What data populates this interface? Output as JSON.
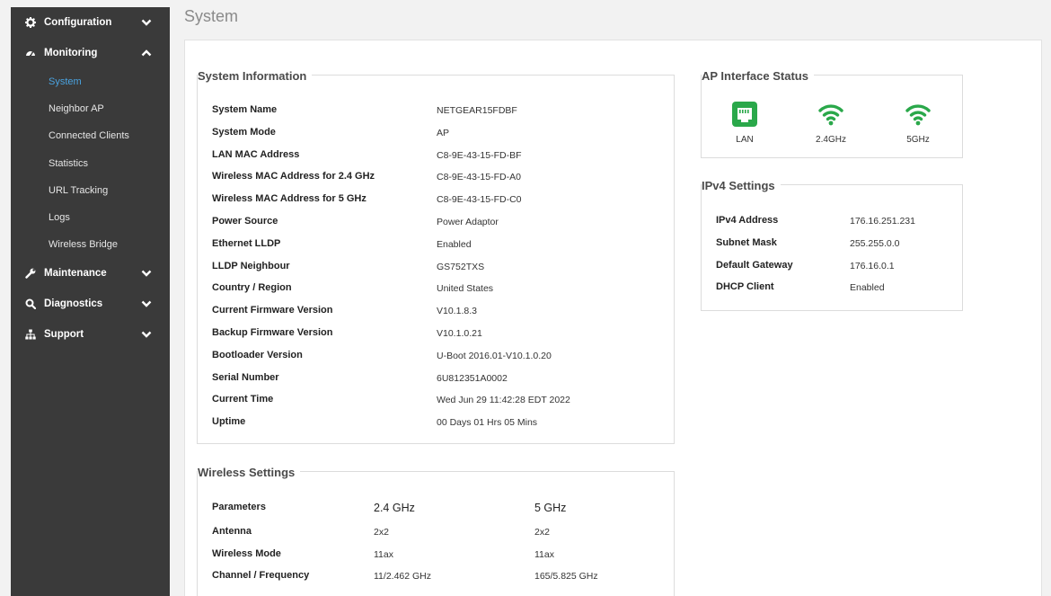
{
  "page": {
    "title": "System"
  },
  "sidebar": {
    "items": [
      {
        "label": "Configuration",
        "icon": "gear-icon",
        "state": "collapsed"
      },
      {
        "label": "Monitoring",
        "icon": "dashboard-icon",
        "state": "expanded",
        "children": [
          "System",
          "Neighbor AP",
          "Connected Clients",
          "Statistics",
          "URL Tracking",
          "Logs",
          "Wireless Bridge"
        ],
        "active_child": "System"
      },
      {
        "label": "Maintenance",
        "icon": "wrench-icon",
        "state": "collapsed"
      },
      {
        "label": "Diagnostics",
        "icon": "search-icon",
        "state": "collapsed"
      },
      {
        "label": "Support",
        "icon": "sitemap-icon",
        "state": "collapsed"
      }
    ]
  },
  "system_info": {
    "title": "System Information",
    "rows": [
      {
        "label": "System Name",
        "value": "NETGEAR15FDBF"
      },
      {
        "label": "System Mode",
        "value": "AP"
      },
      {
        "label": "LAN MAC Address",
        "value": "C8-9E-43-15-FD-BF"
      },
      {
        "label": "Wireless MAC Address for 2.4 GHz",
        "value": "C8-9E-43-15-FD-A0"
      },
      {
        "label": "Wireless MAC Address for 5 GHz",
        "value": "C8-9E-43-15-FD-C0"
      },
      {
        "label": "Power Source",
        "value": "Power Adaptor"
      },
      {
        "label": "Ethernet LLDP",
        "value": "Enabled"
      },
      {
        "label": "LLDP Neighbour",
        "value": "GS752TXS"
      },
      {
        "label": "Country / Region",
        "value": "United States"
      },
      {
        "label": "Current Firmware Version",
        "value": "V10.1.8.3"
      },
      {
        "label": "Backup Firmware Version",
        "value": "V10.1.0.21"
      },
      {
        "label": "Bootloader Version",
        "value": "U-Boot 2016.01-V10.1.0.20"
      },
      {
        "label": "Serial Number",
        "value": "6U812351A0002"
      },
      {
        "label": "Current Time",
        "value": "Wed Jun 29 11:42:28 EDT 2022"
      },
      {
        "label": "Uptime",
        "value": "00 Days 01 Hrs 05 Mins"
      }
    ]
  },
  "wireless_settings": {
    "title": "Wireless Settings",
    "header": {
      "label": "Parameters",
      "col1": "2.4 GHz",
      "col2": "5 GHz"
    },
    "rows": [
      {
        "label": "Antenna",
        "col1": "2x2",
        "col2": "2x2"
      },
      {
        "label": "Wireless Mode",
        "col1": "11ax",
        "col2": "11ax"
      },
      {
        "label": "Channel / Frequency",
        "col1": "11/2.462 GHz",
        "col2": "165/5.825 GHz"
      }
    ]
  },
  "ap_interface_status": {
    "title": "AP Interface Status",
    "items": [
      {
        "label": "LAN",
        "icon": "ethernet-port-icon"
      },
      {
        "label": "2.4GHz",
        "icon": "wifi-icon"
      },
      {
        "label": "5GHz",
        "icon": "wifi-icon"
      }
    ],
    "status_color": "#2aa84a"
  },
  "ipv4": {
    "title": "IPv4 Settings",
    "rows": [
      {
        "label": "IPv4 Address",
        "value": "176.16.251.231"
      },
      {
        "label": "Subnet Mask",
        "value": "255.255.0.0"
      },
      {
        "label": "Default Gateway",
        "value": "176.16.0.1"
      },
      {
        "label": "DHCP Client",
        "value": "Enabled"
      }
    ]
  },
  "colors": {
    "sidebar_bg": "#3a3a3a",
    "active_link": "#4aa3e0",
    "status_green": "#2aa84a"
  }
}
